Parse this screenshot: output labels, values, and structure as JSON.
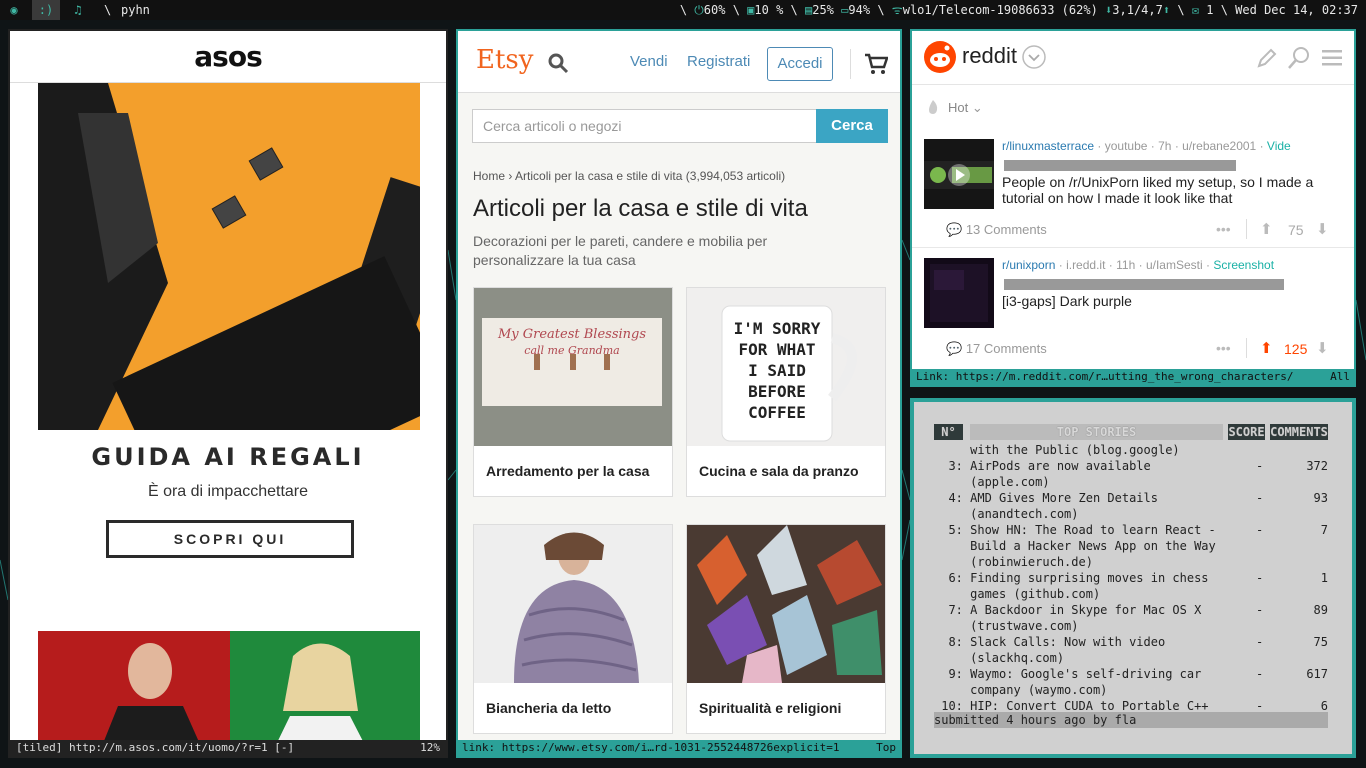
{
  "topbar": {
    "ws_active": ":)",
    "sep1": "\\",
    "app": "pyhn",
    "battery_pct": "60%",
    "cpu": "10 %",
    "mem": "25%",
    "power": "94%",
    "wifi": "wlo1/Telecom-19086633 (62%)",
    "net": "3,1/4,7",
    "mail": "1",
    "clock": "Wed Dec 14, 02:37"
  },
  "asos": {
    "logo": "asos",
    "heading": "GUIDA AI REGALI",
    "subheading": "È ora di impacchettare",
    "cta": "SCOPRI QUI",
    "status": "[tiled] http://m.asos.com/it/uomo/?r=1 [-]",
    "status_pct": "12%"
  },
  "etsy": {
    "brand": "Etsy",
    "nav_vendi": "Vendi",
    "nav_registrati": "Registrati",
    "nav_accedi": "Accedi",
    "search_placeholder": "Cerca articoli o negozi",
    "search_button": "Cerca",
    "breadcrumb_home": "Home",
    "breadcrumb_current": "Articoli per la casa e stile di vita (3,994,053 articoli)",
    "title": "Articoli per la casa e stile di vita",
    "description": "Decorazioni per le pareti, candere e mobilia per personalizzare la tua casa",
    "cards": [
      {
        "label": "Arredamento per la casa"
      },
      {
        "label": "Cucina e sala da pranzo"
      },
      {
        "label": "Biancheria da letto"
      },
      {
        "label": "Spiritualità e religioni"
      }
    ],
    "sign_line1": "My Greatest Blessings",
    "sign_line2": "call me Grandma",
    "mug_text": "I'M SORRY FOR WHAT I SAID BEFORE COFFEE",
    "status": "link: https://www.etsy.com/i…rd-1031-2552448726explicit=1",
    "status_pos": "Top"
  },
  "reddit": {
    "wordmark": "reddit",
    "sort": "Hot",
    "posts": [
      {
        "subreddit": "r/linuxmasterrace",
        "domain": "youtube",
        "age": "7h",
        "user": "u/rebane2001",
        "flair": "Vide",
        "title": "People on /r/UnixPorn liked my setup, so I made a tutorial on how I made it look like that",
        "comments": "13 Comments",
        "score": "75"
      },
      {
        "subreddit": "r/unixporn",
        "domain": "i.redd.it",
        "age": "11h",
        "user": "u/IamSesti",
        "flair": "Screenshot",
        "title": "[i3-gaps] Dark purple",
        "comments": "17 Comments",
        "score": "125"
      }
    ],
    "status": "Link: https://m.reddit.com/r…utting_the_wrong_characters/",
    "status_pos": "All"
  },
  "hn": {
    "col_n": "N°",
    "col_title": "TOP STORIES",
    "col_score": "SCORE",
    "col_comments": "COMMENTS",
    "rows": [
      {
        "text": "     with the Public (blog.google)",
        "score": "",
        "comments": ""
      },
      {
        "text": "  3: AirPods are now available",
        "score": "-",
        "comments": "372"
      },
      {
        "text": "     (apple.com)",
        "score": "",
        "comments": ""
      },
      {
        "text": "  4: AMD Gives More Zen Details",
        "score": "-",
        "comments": "93"
      },
      {
        "text": "     (anandtech.com)",
        "score": "",
        "comments": ""
      },
      {
        "text": "  5: Show HN: The Road to learn React -",
        "score": "-",
        "comments": "7"
      },
      {
        "text": "     Build a Hacker News App on the Way",
        "score": "",
        "comments": ""
      },
      {
        "text": "     (robinwieruch.de)",
        "score": "",
        "comments": ""
      },
      {
        "text": "  6: Finding surprising moves in chess",
        "score": "-",
        "comments": "1"
      },
      {
        "text": "     games (github.com)",
        "score": "",
        "comments": ""
      },
      {
        "text": "  7: A Backdoor in Skype for Mac OS X",
        "score": "-",
        "comments": "89"
      },
      {
        "text": "     (trustwave.com)",
        "score": "",
        "comments": ""
      },
      {
        "text": "  8: Slack Calls: Now with video",
        "score": "-",
        "comments": "75"
      },
      {
        "text": "     (slackhq.com)",
        "score": "",
        "comments": ""
      },
      {
        "text": "  9: Waymo: Google's self-driving car",
        "score": "-",
        "comments": "617"
      },
      {
        "text": "     company (waymo.com)",
        "score": "",
        "comments": ""
      },
      {
        "text": " 10: HIP: Convert CUDA to Portable C++",
        "score": "-",
        "comments": "6"
      }
    ],
    "footer": "submitted 4 hours ago by fla"
  }
}
